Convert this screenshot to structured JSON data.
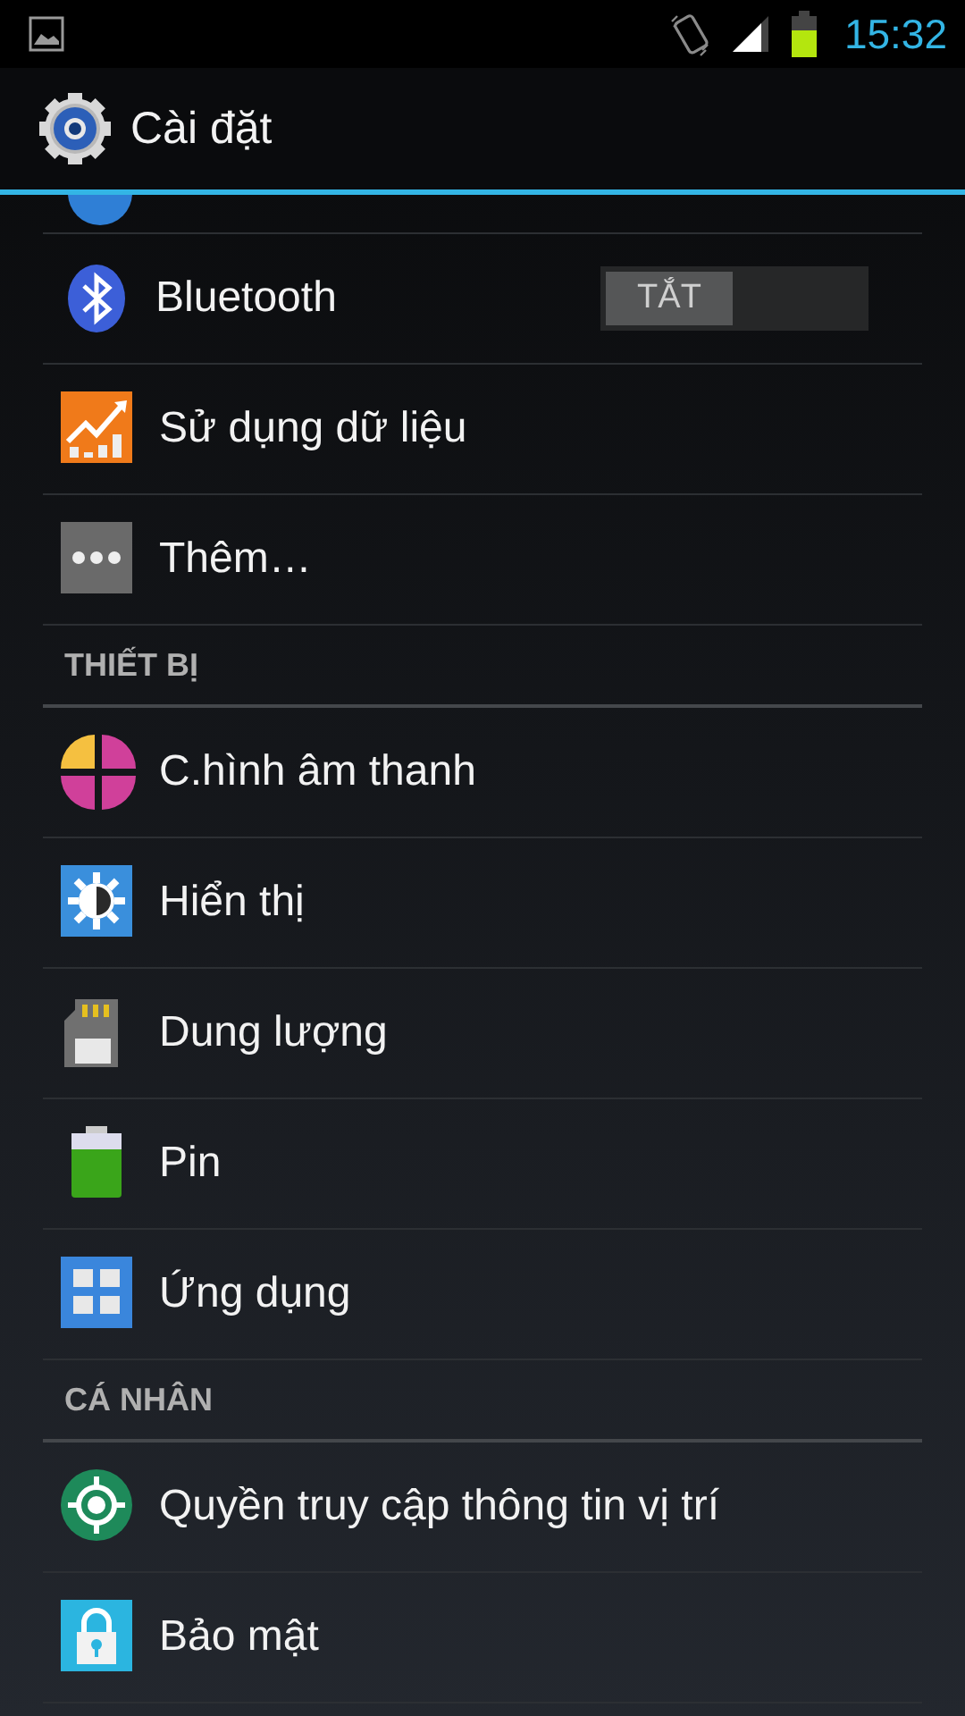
{
  "status_bar": {
    "time": "15:32"
  },
  "action_bar": {
    "title": "Cài đặt"
  },
  "list": [
    {
      "kind": "toggle",
      "label": "Bluetooth",
      "switch_label": "TẮT",
      "on": false
    },
    {
      "kind": "item",
      "label": "Sử dụng dữ liệu"
    },
    {
      "kind": "item",
      "label": "Thêm…"
    },
    {
      "kind": "header",
      "label": "THIẾT BỊ"
    },
    {
      "kind": "item",
      "label": "C.hình âm thanh"
    },
    {
      "kind": "item",
      "label": "Hiển thị"
    },
    {
      "kind": "item",
      "label": "Dung lượng"
    },
    {
      "kind": "item",
      "label": "Pin"
    },
    {
      "kind": "item",
      "label": "Ứng dụng"
    },
    {
      "kind": "header",
      "label": "CÁ NHÂN"
    },
    {
      "kind": "item",
      "label": "Quyền truy cập thông tin vị trí"
    },
    {
      "kind": "item",
      "label": "Bảo mật"
    }
  ]
}
